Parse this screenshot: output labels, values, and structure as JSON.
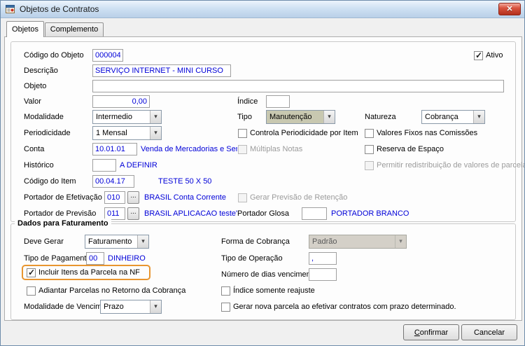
{
  "colors": {
    "value_text": "#0000d8",
    "highlight": "#e8952f",
    "tipo_combo_bg": "#c8c8b0",
    "disabled_combo_bg": "#d4d0c8"
  },
  "icons": {
    "close": "✕",
    "dropdown_arrow": "▾",
    "browse": "..."
  },
  "window": {
    "title": "Objetos de Contratos"
  },
  "tabs": {
    "objetos": "Objetos",
    "complemento": "Complemento"
  },
  "objetos": {
    "codigo_objeto": {
      "label": "Código do Objeto",
      "value": "000004"
    },
    "ativo": {
      "label": "Ativo",
      "checked": true
    },
    "descricao": {
      "label": "Descrição",
      "value": "SERVIÇO INTERNET - MINI CURSO"
    },
    "objeto": {
      "label": "Objeto",
      "value": ""
    },
    "valor": {
      "label": "Valor",
      "value": "0,00"
    },
    "indice": {
      "label": "Índice",
      "value": ""
    },
    "modalidade": {
      "label": "Modalidade",
      "value": "Intermedio"
    },
    "tipo": {
      "label": "Tipo",
      "value": "Manutenção"
    },
    "natureza": {
      "label": "Natureza",
      "value": "Cobrança"
    },
    "periodicidade": {
      "label": "Periodicidade",
      "value": "1 Mensal"
    },
    "controla_periodicidade": {
      "label": "Controla Periodicidade por Item",
      "checked": false
    },
    "valores_fixos": {
      "label": "Valores Fixos nas Comissões",
      "checked": false
    },
    "conta": {
      "label": "Conta",
      "value": "10.01.01",
      "desc": "Venda de Mercadorias e Servicos Tes"
    },
    "multiplas_notas": {
      "label": "Múltiplas Notas",
      "checked": false
    },
    "reserva_espaco": {
      "label": "Reserva de Espaço",
      "checked": false
    },
    "historico": {
      "label": "Histórico",
      "value": "",
      "desc": "A DEFINIR"
    },
    "permitir_redistribuicao": {
      "label": "Permitir redistribuição de valores de parcela",
      "checked": false
    },
    "codigo_item": {
      "label": "Código do Item",
      "value": "00.04.17",
      "desc": "TESTE 50 X 50"
    },
    "portador_efetivacao": {
      "label": "Portador de Efetivação",
      "value": "010",
      "desc": "BRASIL Conta Corrente"
    },
    "gerar_previsao": {
      "label": "Gerar Previsão de Retenção",
      "checked": false
    },
    "portador_previsao": {
      "label": "Portador de Previsão",
      "value": "011",
      "desc": "BRASIL APLICACAO teste'"
    },
    "portador_glosa": {
      "label": "Portador Glosa",
      "value": "",
      "desc": "PORTADOR BRANCO"
    }
  },
  "faturamento": {
    "title": "Dados para Faturamento",
    "deve_gerar": {
      "label": "Deve Gerar",
      "value": "Faturamento"
    },
    "forma_cobranca": {
      "label": "Forma de Cobrança",
      "value": "Padrão"
    },
    "tipo_pagamento": {
      "label": "Tipo de Pagamento",
      "value": "00",
      "desc": "DINHEIRO"
    },
    "tipo_operacao": {
      "label": "Tipo de Operação",
      "value": ","
    },
    "incluir_itens": {
      "label": "Incluir Itens da Parcela na NF",
      "checked": true
    },
    "numero_dias": {
      "label": "Número de dias vencimento",
      "value": ""
    },
    "adiantar_parcelas": {
      "label": "Adiantar Parcelas no Retorno da Cobrança",
      "checked": false
    },
    "indice_reajuste": {
      "label": "Índice somente reajuste",
      "checked": false
    },
    "modalidade_vencimento": {
      "label": "Modalidade de Vencimento",
      "value": "Prazo"
    },
    "gerar_nova_parcela": {
      "label": "Gerar nova parcela ao efetivar contratos com prazo determinado.",
      "checked": false
    }
  },
  "footer": {
    "confirmar": "Confirmar",
    "cancelar": "Cancelar"
  }
}
